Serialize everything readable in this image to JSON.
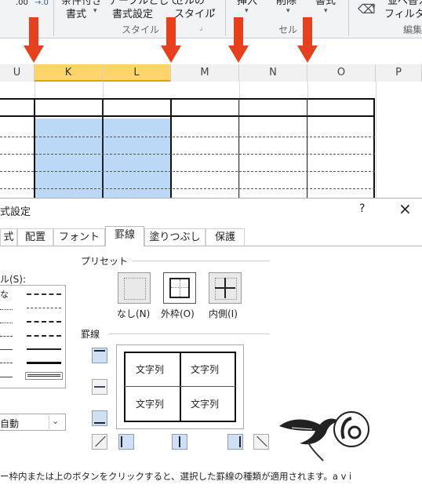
{
  "ribbon": {
    "top_left_a": ".00",
    "top_left_b": "→.0",
    "style_btn1_top": "条件付き",
    "style_btn1": "書式",
    "style_btn2_top": "テーブルとして",
    "style_btn2": "書式設定",
    "style_btn3_top": "セルの",
    "style_btn3": "スタイル",
    "group_style": "スタイル",
    "cell_btn1": "挿入",
    "cell_btn2": "削除",
    "cell_btn3": "書式",
    "group_cell": "セル",
    "edit_btn_top": "並べ替えと",
    "edit_btn": "フィルター",
    "group_edit": "編集"
  },
  "columns": [
    "U",
    "K",
    "L",
    "M",
    "N",
    "O",
    "P"
  ],
  "dialog": {
    "title": "式設定",
    "help": "?",
    "close": "×",
    "tabs": [
      "式",
      "配置",
      "フォント",
      "罫線",
      "塗りつぶし",
      "保護"
    ],
    "active_tab": "罫線",
    "line_style_label": "ル(S):",
    "line_none": "な",
    "color_value": "自動",
    "preset_label": "プリセット",
    "preset_none": "なし(N)",
    "preset_outline": "外枠(O)",
    "preset_inside": "内側(I)",
    "border_label": "罫線",
    "preview_text": "文字列",
    "hint": "ー枠内または上のボタンをクリックすると、選択した罫線の種類が適用されます。a v i"
  }
}
